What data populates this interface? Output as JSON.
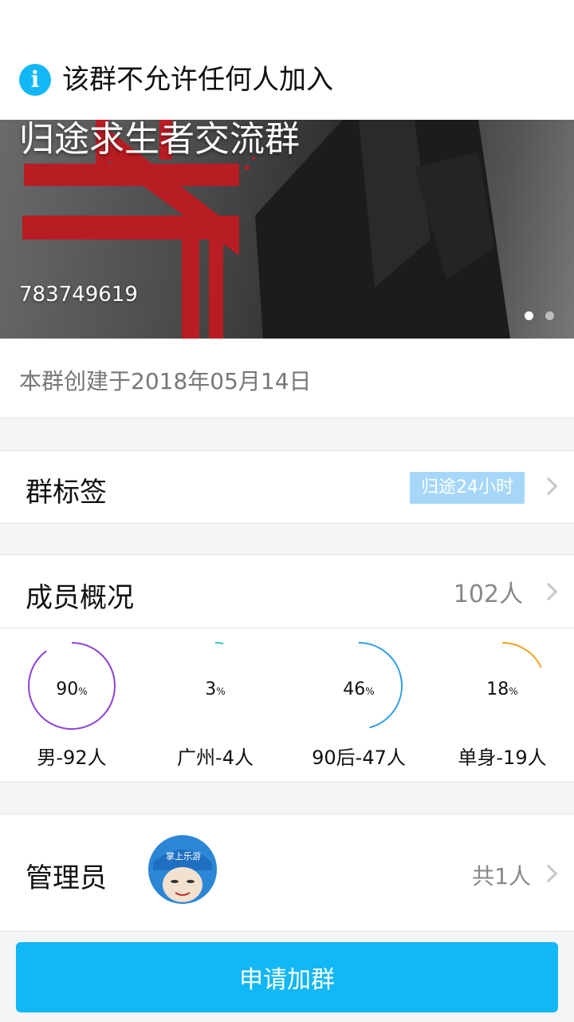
{
  "notice": {
    "icon": "info-icon",
    "text": "该群不允许任何人加入"
  },
  "banner": {
    "group_name": "归途求生者交流群",
    "group_id": "783749619",
    "pages": 2,
    "current_page": 1
  },
  "created": {
    "text": "本群创建于2018年05月14日"
  },
  "tags": {
    "label": "群标签",
    "tag": "归途24小时"
  },
  "members": {
    "label": "成员概况",
    "count": "102人",
    "stats": [
      {
        "value": 90,
        "pct_text": "90",
        "unit": "%",
        "caption": "男-92人",
        "color": "#8e3fd6"
      },
      {
        "value": 3,
        "pct_text": "3",
        "unit": "%",
        "caption": "广州-4人",
        "color": "#35c2c9"
      },
      {
        "value": 46,
        "pct_text": "46",
        "unit": "%",
        "caption": "90后-47人",
        "color": "#2a9be6"
      },
      {
        "value": 18,
        "pct_text": "18",
        "unit": "%",
        "caption": "单身-19人",
        "color": "#f0a020"
      }
    ]
  },
  "admin": {
    "label": "管理员",
    "avatar_text": "掌上乐游",
    "count": "共1人"
  },
  "footer": {
    "join_label": "申请加群"
  },
  "colors": {
    "accent": "#12b7f5",
    "tag_bg": "#a6d7f8"
  }
}
